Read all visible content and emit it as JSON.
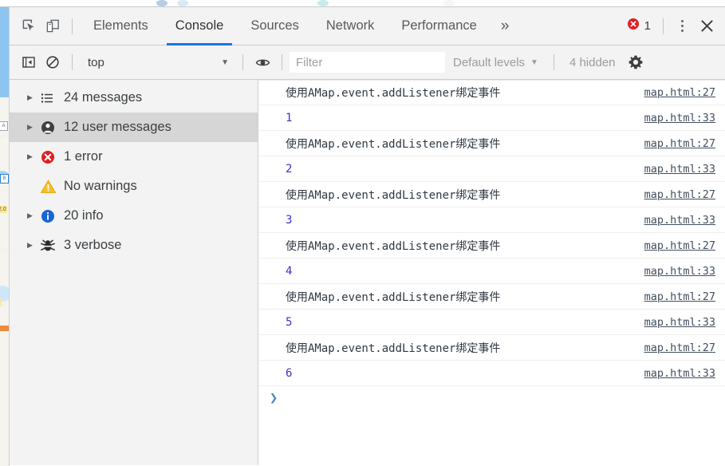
{
  "window": {
    "left_page_strip_color": "#8ec5f0",
    "panel_bg": "#f3f3f3"
  },
  "main_toolbar": {
    "inspect_icon": "inspect-element-icon",
    "device_icon": "device-toolbar-icon",
    "tabs": [
      {
        "id": "elements",
        "label": "Elements",
        "active": false
      },
      {
        "id": "console",
        "label": "Console",
        "active": true
      },
      {
        "id": "sources",
        "label": "Sources",
        "active": false
      },
      {
        "id": "network",
        "label": "Network",
        "active": false
      },
      {
        "id": "performance",
        "label": "Performance",
        "active": false
      }
    ],
    "more_tabs_label": "»",
    "error_badge": {
      "icon": "error-circle-icon",
      "count": "1",
      "color": "#e02020"
    },
    "kebab_label": "customize-and-control",
    "close_label": "✕",
    "active_tab_underline": "#1a73e8"
  },
  "console_toolbar": {
    "sidebar_toggle_icon": "console-sidebar-toggle-icon",
    "clear_icon": "clear-console-icon",
    "context": {
      "value": "top",
      "caret": "▼"
    },
    "eye_icon": "live-expression-eye-icon",
    "filter": {
      "value": "",
      "placeholder": "Filter"
    },
    "levels": {
      "label": "Default levels",
      "caret": "▼"
    },
    "hidden_label": "4 hidden",
    "settings_icon": "settings-gear-icon"
  },
  "sidebar": {
    "items": [
      {
        "label": "24 messages",
        "icon": "list-icon",
        "twisty": true,
        "selected": false
      },
      {
        "label": "12 user messages",
        "icon": "user-icon",
        "twisty": true,
        "selected": true
      },
      {
        "label": "1 error",
        "icon": "error-icon",
        "twisty": true,
        "selected": false
      },
      {
        "label": "No warnings",
        "icon": "warning-icon",
        "twisty": false,
        "selected": false
      },
      {
        "label": "20 info",
        "icon": "info-icon",
        "twisty": true,
        "selected": false
      },
      {
        "label": "3 verbose",
        "icon": "verbose-icon",
        "twisty": true,
        "selected": false
      }
    ]
  },
  "messages": {
    "rows": [
      {
        "text": "使用AMap.event.addListener绑定事件",
        "kind": "log",
        "link": "map.html:27"
      },
      {
        "text": "1",
        "kind": "number",
        "link": "map.html:33"
      },
      {
        "text": "使用AMap.event.addListener绑定事件",
        "kind": "log",
        "link": "map.html:27"
      },
      {
        "text": "2",
        "kind": "number",
        "link": "map.html:33"
      },
      {
        "text": "使用AMap.event.addListener绑定事件",
        "kind": "log",
        "link": "map.html:27"
      },
      {
        "text": "3",
        "kind": "number",
        "link": "map.html:33"
      },
      {
        "text": "使用AMap.event.addListener绑定事件",
        "kind": "log",
        "link": "map.html:27"
      },
      {
        "text": "4",
        "kind": "number",
        "link": "map.html:33"
      },
      {
        "text": "使用AMap.event.addListener绑定事件",
        "kind": "log",
        "link": "map.html:27"
      },
      {
        "text": "5",
        "kind": "number",
        "link": "map.html:33"
      },
      {
        "text": "使用AMap.event.addListener绑定事件",
        "kind": "log",
        "link": "map.html:27"
      },
      {
        "text": "6",
        "kind": "number",
        "link": "map.html:33"
      }
    ],
    "prompt_caret": "❯"
  },
  "map_sliver": {
    "label": "2.0"
  }
}
